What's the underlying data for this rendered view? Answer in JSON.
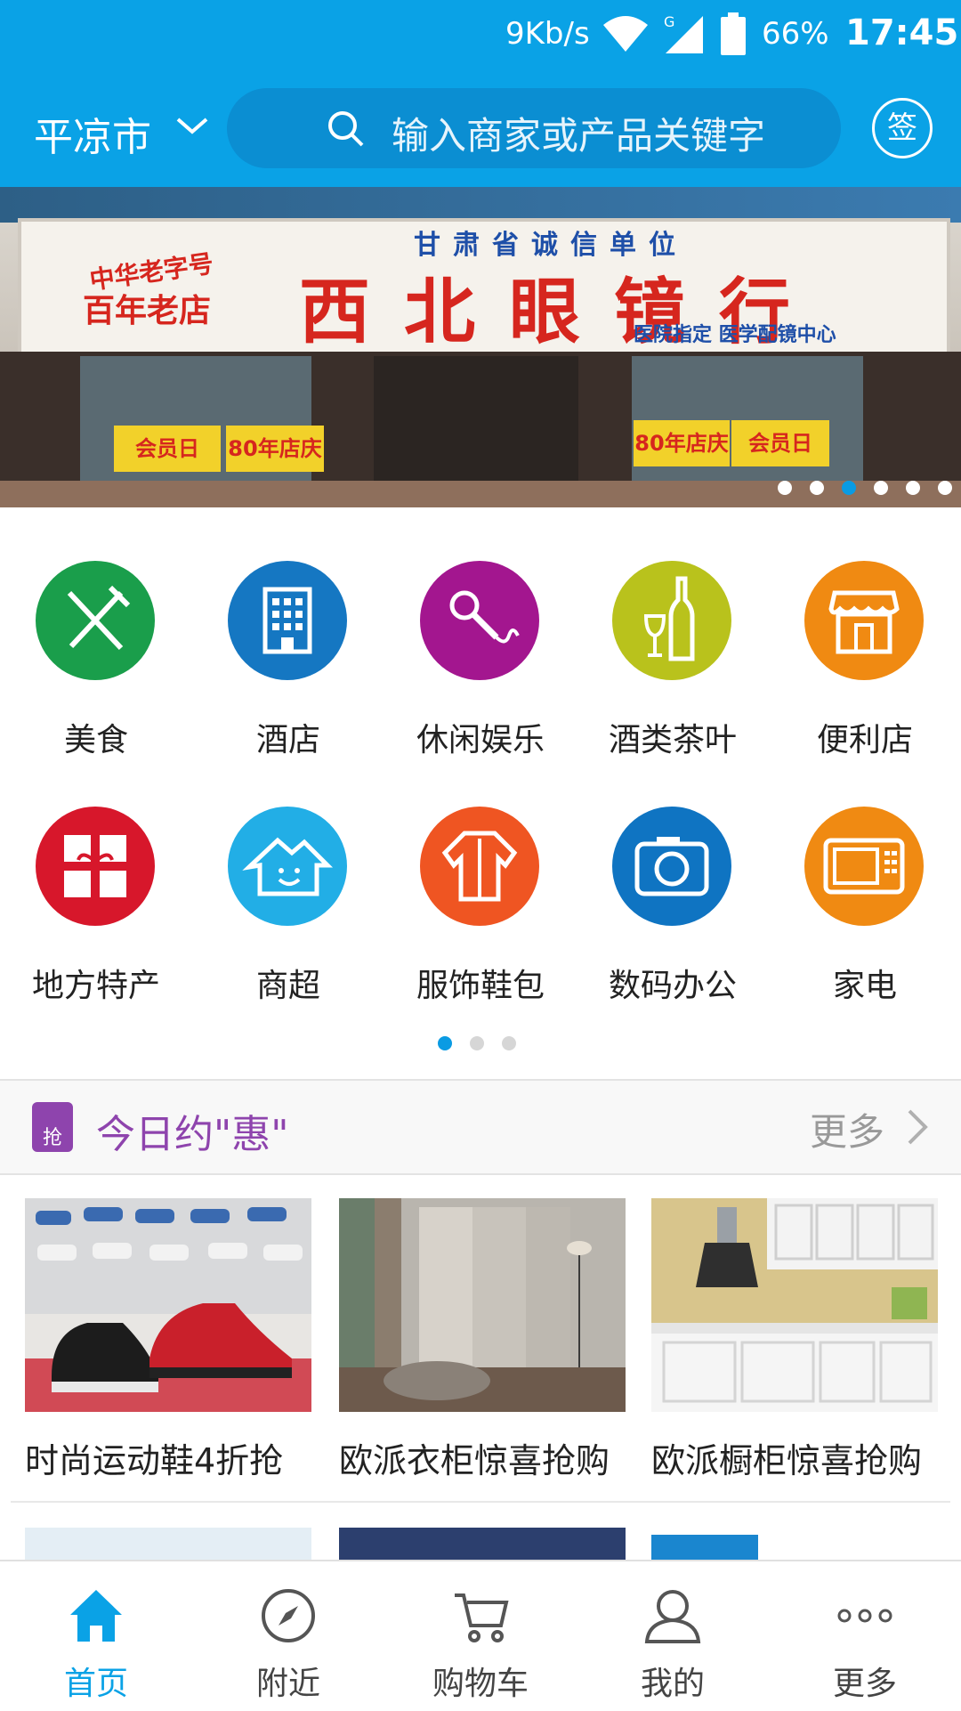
{
  "status": {
    "network": "9Kb/s",
    "battery": "66%",
    "time": "17:45",
    "signal_label": "G"
  },
  "header": {
    "city": "平凉市",
    "search_placeholder": "输入商家或产品关键字",
    "sign_label": "签"
  },
  "banner": {
    "store_top": "甘肃省诚信单位",
    "store_name": "西北眼镜行",
    "left_tag1": "中华老字号",
    "left_tag2": "百年老店",
    "right_tag": "医院指定 医学配镜中心",
    "poster1": "会员日",
    "poster2": "80年店庆",
    "poster3": "80年店庆",
    "poster4": "会员日",
    "slides": 6,
    "active_slide": 3
  },
  "categories": [
    {
      "label": "美食",
      "icon": "fork-knife-icon",
      "color": "#1a9e4b"
    },
    {
      "label": "酒店",
      "icon": "hotel-building-icon",
      "color": "#1577c2"
    },
    {
      "label": "休闲娱乐",
      "icon": "microphone-icon",
      "color": "#a3168f"
    },
    {
      "label": "酒类茶叶",
      "icon": "wine-bottle-icon",
      "color": "#b9c21c"
    },
    {
      "label": "便利店",
      "icon": "storefront-icon",
      "color": "#f08a12"
    },
    {
      "label": "地方特产",
      "icon": "gift-icon",
      "color": "#d7172b"
    },
    {
      "label": "商超",
      "icon": "house-smile-icon",
      "color": "#22aee6"
    },
    {
      "label": "服饰鞋包",
      "icon": "shirt-icon",
      "color": "#ef5522"
    },
    {
      "label": "数码办公",
      "icon": "camera-icon",
      "color": "#0f74c2"
    },
    {
      "label": "家电",
      "icon": "microwave-icon",
      "color": "#f08a12"
    }
  ],
  "category_pages": 3,
  "category_active_page": 1,
  "deals": {
    "icon_label": "抢",
    "title": "今日约\"惠\"",
    "more": "更多",
    "items": [
      {
        "title": "时尚运动鞋4折抢"
      },
      {
        "title": "欧派衣柜惊喜抢购"
      },
      {
        "title": "欧派橱柜惊喜抢购"
      }
    ]
  },
  "tabs": [
    {
      "label": "首页",
      "icon": "home-icon",
      "active": true
    },
    {
      "label": "附近",
      "icon": "compass-icon",
      "active": false
    },
    {
      "label": "购物车",
      "icon": "cart-icon",
      "active": false
    },
    {
      "label": "我的",
      "icon": "user-icon",
      "active": false
    },
    {
      "label": "更多",
      "icon": "more-dots-icon",
      "active": false
    }
  ]
}
